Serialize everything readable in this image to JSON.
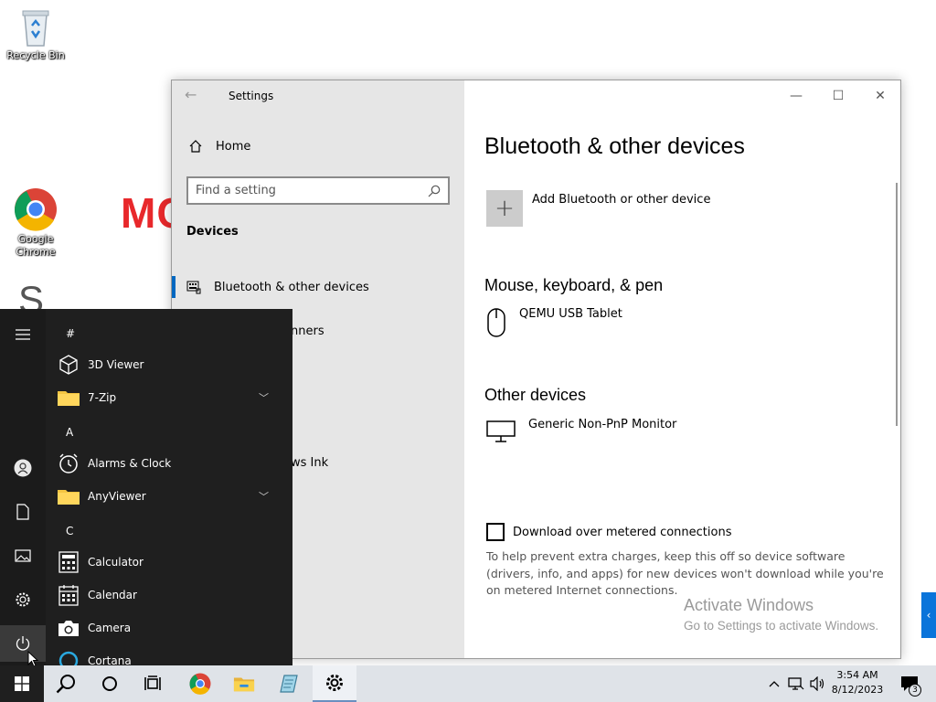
{
  "desktop": {
    "icons": [
      {
        "label": "Recycle Bin",
        "icon": "recycle-bin-icon"
      },
      {
        "label": "Google Chrome",
        "icon": "chrome-icon"
      }
    ],
    "background_text": "MC"
  },
  "settings": {
    "title": "Settings",
    "nav": {
      "home_label": "Home",
      "search_placeholder": "Find a setting",
      "section_label": "Devices",
      "items": [
        {
          "label": "Bluetooth & other devices",
          "active": true
        },
        {
          "label": "nners"
        },
        {
          "label": "ws Ink"
        }
      ]
    },
    "main": {
      "page_title": "Bluetooth & other devices",
      "add_label": "Add Bluetooth or other device",
      "section_mouse": "Mouse, keyboard, & pen",
      "mouse_device": "QEMU USB Tablet",
      "section_other": "Other devices",
      "other_device": "Generic Non-PnP Monitor",
      "metered_label": "Download over metered connections",
      "metered_help": "To help prevent extra charges, keep this off so device software (drivers, info, and apps) for new devices won't download while you're on metered Internet connections."
    }
  },
  "watermark": {
    "line1": "Activate Windows",
    "line2": "Go to Settings to activate Windows."
  },
  "start_menu": {
    "groups": [
      {
        "letter": "#",
        "apps": [
          {
            "label": "3D Viewer",
            "icon": "3d-viewer-icon"
          },
          {
            "label": "7-Zip",
            "icon": "folder-icon",
            "expandable": true
          }
        ]
      },
      {
        "letter": "A",
        "apps": [
          {
            "label": "Alarms & Clock",
            "icon": "alarm-clock-icon"
          },
          {
            "label": "AnyViewer",
            "icon": "folder-icon",
            "expandable": true
          }
        ]
      },
      {
        "letter": "C",
        "apps": [
          {
            "label": "Calculator",
            "icon": "calculator-icon"
          },
          {
            "label": "Calendar",
            "icon": "calendar-icon"
          },
          {
            "label": "Camera",
            "icon": "camera-icon"
          },
          {
            "label": "Cortana",
            "icon": "cortana-icon"
          }
        ]
      }
    ]
  },
  "taskbar": {
    "clock_time": "3:54 AM",
    "clock_date": "8/12/2023",
    "notification_count": "3"
  },
  "colors": {
    "accent": "#0067c0",
    "start_bg": "#1f1f1f",
    "settings_nav_bg": "#e6e6e6",
    "taskbar_bg": "#dfe3e8"
  }
}
